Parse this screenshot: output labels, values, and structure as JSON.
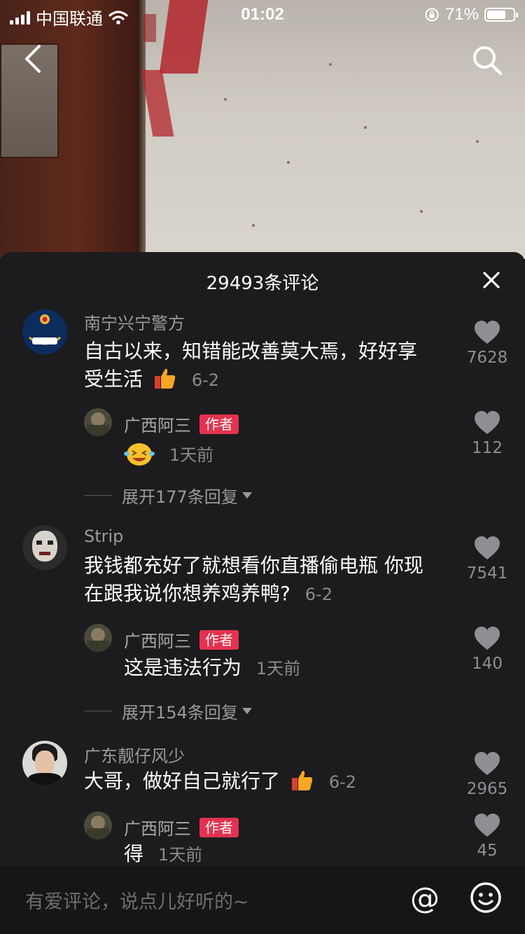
{
  "status_bar": {
    "carrier": "中国联通",
    "time": "01:02",
    "battery": "71%",
    "battery_level": 0.71
  },
  "header": {
    "back_icon": "chevron-left-icon",
    "search_icon": "search-icon"
  },
  "panel": {
    "title": "29493条评论",
    "close_icon": "close-icon"
  },
  "comments": [
    {
      "user": "南宁兴宁警方",
      "avatar_text": "兴宁警方",
      "avatar_sub": "POLICE",
      "text_line1": "自古以来，知错能改善莫大焉，好好享",
      "text_line2": "受生活",
      "emoji": "thumbs-up-icon",
      "date": "6-2",
      "likes": "7628",
      "reply": {
        "user": "广西阿三",
        "tag": "作者",
        "emoji": "laughing-emoji-icon",
        "text": "",
        "date": "1天前",
        "likes": "112"
      },
      "expand": "展开177条回复"
    },
    {
      "user": "Strip",
      "text_line1": "我钱都充好了就想看你直播偷电瓶 你现",
      "text_line2": "在跟我说你想养鸡养鸭?",
      "date": "6-2",
      "likes": "7541",
      "reply": {
        "user": "广西阿三",
        "tag": "作者",
        "text": "这是违法行为",
        "date": "1天前",
        "likes": "140"
      },
      "expand": "展开154条回复"
    },
    {
      "user": "广东靓仔风少",
      "text_line1": "大哥，做好自己就行了",
      "emoji": "thumbs-up-icon",
      "date": "6-2",
      "likes": "2965",
      "reply": {
        "user": "广西阿三",
        "tag": "作者",
        "text": "得",
        "date": "1天前",
        "likes": "45"
      }
    }
  ],
  "input_bar": {
    "placeholder": "有爱评论，说点儿好听的~",
    "at_symbol": "@",
    "emoji_icon": "smile-icon"
  },
  "colors": {
    "panel_bg": "#1c1c1e",
    "author_tag": "#e4314f",
    "muted_text": "#9a9a9e"
  }
}
